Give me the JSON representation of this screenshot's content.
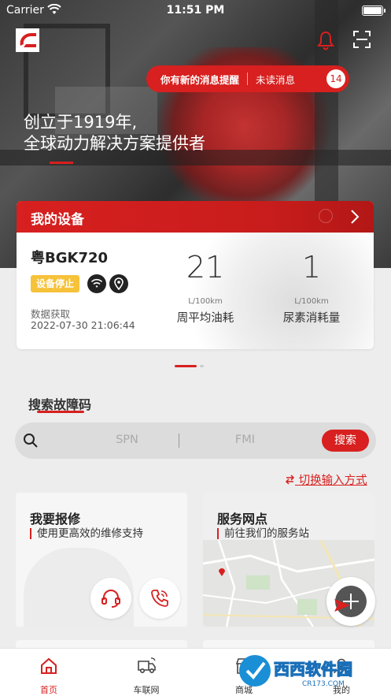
{
  "status_bar": {
    "carrier": "Carrier",
    "time": "11:51 PM"
  },
  "header": {
    "logo": "cummins-logo-icon",
    "logo_text": "Cummins",
    "notice": {
      "text": "你有新的消息提醒",
      "unread_label": "未读消息",
      "unread_count": "14"
    }
  },
  "hero": {
    "slogan_line1": "创立于1919年,",
    "slogan_line2": "全球动力解决方案提供者"
  },
  "device": {
    "title": "我的设备",
    "plate": "粤BGK720",
    "status": "设备停止",
    "data_label": "数据获取",
    "data_time": "2022-07-30 21:06:44",
    "metrics": [
      {
        "value": "21",
        "unit": "L/100km",
        "label": "周平均油耗"
      },
      {
        "value": "1",
        "unit": "L/100km",
        "label": "尿素消耗量"
      }
    ]
  },
  "search": {
    "section_title": "搜索故障码",
    "spn_placeholder": "SPN",
    "fmi_placeholder": "FMI",
    "button": "搜索",
    "switch_label": "切换输入方式"
  },
  "cards": [
    {
      "title": "我要报修",
      "subtitle": "使用更高效的维修支持"
    },
    {
      "title": "服务网点",
      "subtitle": "前往我们的服务站"
    }
  ],
  "tabs": [
    {
      "label": "首页",
      "icon": "home-icon"
    },
    {
      "label": "车联网",
      "icon": "truck-icon"
    },
    {
      "label": "商城",
      "icon": "shop-icon"
    },
    {
      "label": "我的",
      "icon": "user-icon"
    }
  ],
  "watermark": {
    "text1": "西西软件园",
    "text2": "CR173.COM"
  },
  "colors": {
    "accent": "#d7201f",
    "badge": "#f6c23a"
  }
}
